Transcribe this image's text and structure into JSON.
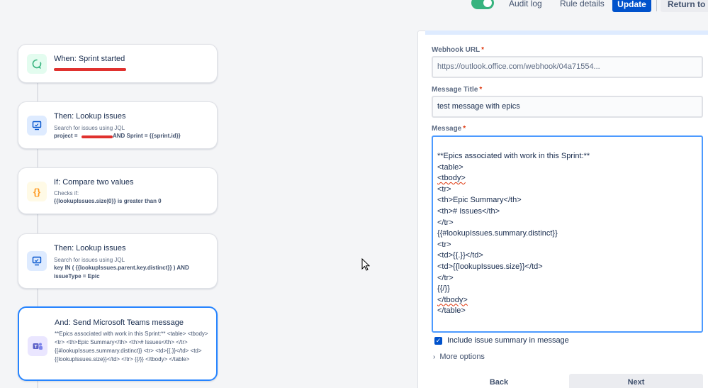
{
  "topbar": {
    "audit_log": "Audit log",
    "rule_details": "Rule details",
    "update": "Update",
    "return": "Return to ru"
  },
  "flow": {
    "trigger": {
      "title": "When: Sprint started",
      "icon": "sprint-trigger-icon",
      "color": "#57d9a3"
    },
    "lookup1": {
      "title": "Then: Lookup issues",
      "subtitle": "Search for issues using JQL",
      "code_start": "project =",
      "code_end": "AND Sprint = {{sprint.id}}",
      "icon": "lookup-issues-icon"
    },
    "condition": {
      "title": "If: Compare two values",
      "subtitle": "Checks if:",
      "code": "{{lookupIssues.size|0}} is greater than 0",
      "icon": "braces-icon"
    },
    "lookup2": {
      "title": "Then: Lookup issues",
      "subtitle": "Search for issues using JQL",
      "code": "key IN ( {{lookupIssues.parent.key.distinct}} ) AND issueType = Epic",
      "icon": "lookup-issues-icon"
    },
    "teams": {
      "title": "And: Send Microsoft Teams message",
      "body": "**Epics associated with work in this Sprint:** <table> <tbody> <tr> <th>Epic Summary</th> <th># Issues</th> </tr> {{#lookupIssues.summary.distinct}} <tr> <td>{{.}}</td> <td>{{lookupIssues.size}}</td> </tr> {{/}} </tbody> </table>",
      "icon": "teams-icon"
    }
  },
  "form": {
    "webhook": {
      "label": "Webhook URL",
      "value": "https://outlook.office.com/webhook/04a71554..."
    },
    "title": {
      "label": "Message Title",
      "value": "test message with epics"
    },
    "message": {
      "label": "Message",
      "lines": [
        "**Epics associated with work in this Sprint:**",
        "<table>",
        "<tbody>",
        "<tr>",
        "<th>Epic Summary</th>",
        "<th># Issues</th>",
        "</tr>",
        "{{#lookupIssues.summary.distinct}}",
        "<tr>",
        "<td>{{.}}</td>",
        "<td>{{lookupIssues.size}}</td>",
        "</tr>",
        "{{/}}",
        "</tbody>",
        "</table>"
      ]
    },
    "include_summary": "Include issue summary in message",
    "more_options": "More options",
    "back": "Back",
    "next": "Next"
  },
  "colors": {
    "accent": "#0052cc",
    "focus": "#4c9aff",
    "toggle_on": "#36b37e",
    "redaction": "#e0312e"
  }
}
